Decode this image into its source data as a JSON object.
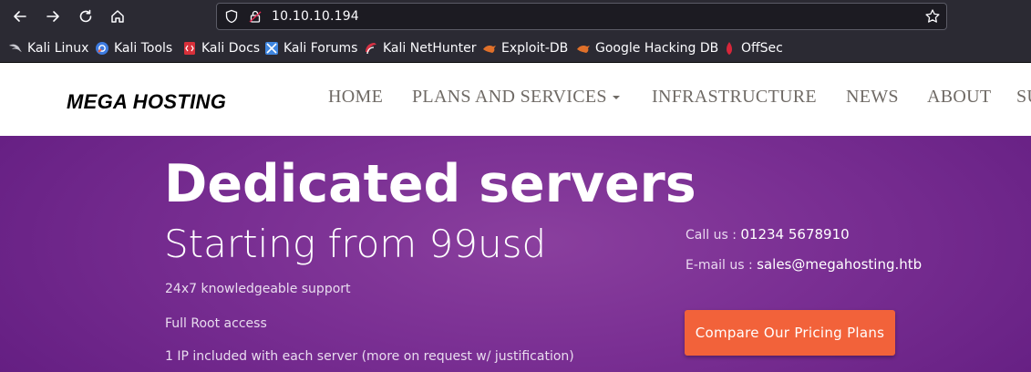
{
  "browser": {
    "url": "10.10.10.194",
    "bookmarks": [
      {
        "label": "Kali Linux",
        "icon": "kali-dragon-icon"
      },
      {
        "label": "Kali Tools",
        "icon": "kali-tools-icon"
      },
      {
        "label": "Kali Docs",
        "icon": "kali-docs-icon"
      },
      {
        "label": "Kali Forums",
        "icon": "kali-forums-icon"
      },
      {
        "label": "Kali NetHunter",
        "icon": "kali-nethunter-icon"
      },
      {
        "label": "Exploit-DB",
        "icon": "exploit-db-icon"
      },
      {
        "label": "Google Hacking DB",
        "icon": "ghdb-icon"
      },
      {
        "label": "OffSec",
        "icon": "offsec-icon"
      }
    ]
  },
  "site": {
    "logo": "MEGA HOSTING",
    "menu": [
      "HOME",
      "PLANS AND SERVICES",
      "INFRASTRUCTURE",
      "NEWS",
      "ABOUT",
      "SU"
    ],
    "hero": {
      "title": "Dedicated servers",
      "subtitle": "Starting from 99usd",
      "features": [
        "24x7 knowledgeable support",
        "Full Root access",
        "1 IP included with each server (more on request w/ justification)"
      ],
      "call_label": "Call us : ",
      "call_value": "01234 5678910",
      "email_label": "E-mail us : ",
      "email_value": "sales@megahosting.htb",
      "cta": "Compare Our Pricing Plans"
    }
  },
  "colors": {
    "toolbar_bg": "#2b2a33",
    "hero_purple": "#7a2f93",
    "cta_orange": "#f2623a"
  }
}
